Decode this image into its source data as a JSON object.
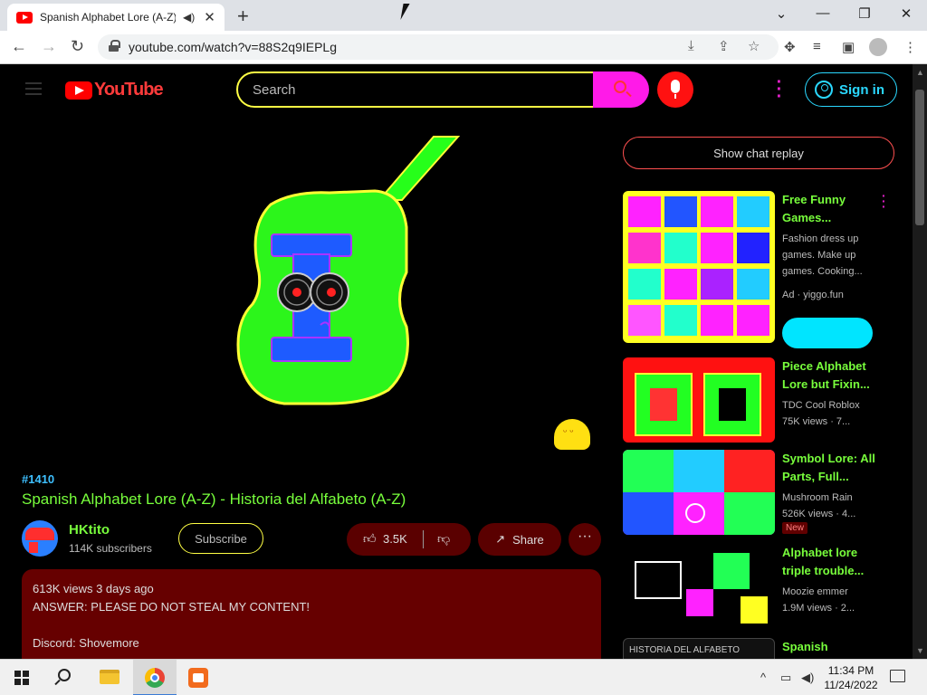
{
  "browser": {
    "tab_title": "Spanish Alphabet Lore (A-Z) - Historia del Alfabeto (A-Z)",
    "url": "youtube.com/watch?v=88S2q9IEPLg"
  },
  "header": {
    "logo_text": "YouTube",
    "search_placeholder": "Search",
    "signin_label": "Sign in"
  },
  "video": {
    "hashtag": "#1410",
    "title": "Spanish Alphabet Lore (A-Z) - Historia del Alfabeto (A-Z)",
    "channel_name": "HKtito",
    "subscribers": "114K subscribers",
    "subscribe_label": "Subscribe",
    "like_count": "3.5K",
    "share_label": "Share",
    "description": {
      "stats": "613K views  3 days ago",
      "line1": "ANSWER: PLEASE DO NOT STEAL MY CONTENT!",
      "line2": "Discord: Shovemore"
    }
  },
  "sidebar": {
    "chat_replay_label": "Show chat replay",
    "recommendations": [
      {
        "title": "Free Funny Games...",
        "description": "Fashion dress up games. Make up games. Cooking...",
        "meta": "Ad · yiggo.fun",
        "thumb_type": "ad"
      },
      {
        "title": "Piece Alphabet Lore but Fixin...",
        "channel": "TDC Cool Roblox",
        "meta": "75K views · 7...",
        "thumb_type": "red"
      },
      {
        "title": "Symbol Lore: All Parts, Full...",
        "channel": "Mushroom Rain",
        "meta": "526K views · 4...",
        "badge": "New",
        "thumb_type": "noise"
      },
      {
        "title": "Alphabet lore triple trouble...",
        "channel": "Moozie emmer",
        "meta": "1.9M views · 2...",
        "thumb_type": "noise2"
      },
      {
        "title": "Spanish",
        "thumb_type": "dark",
        "thumb_caption": "HISTORIA DEL ALFABETO"
      }
    ]
  },
  "taskbar": {
    "time": "11:34 PM",
    "date": "11/24/2022"
  }
}
